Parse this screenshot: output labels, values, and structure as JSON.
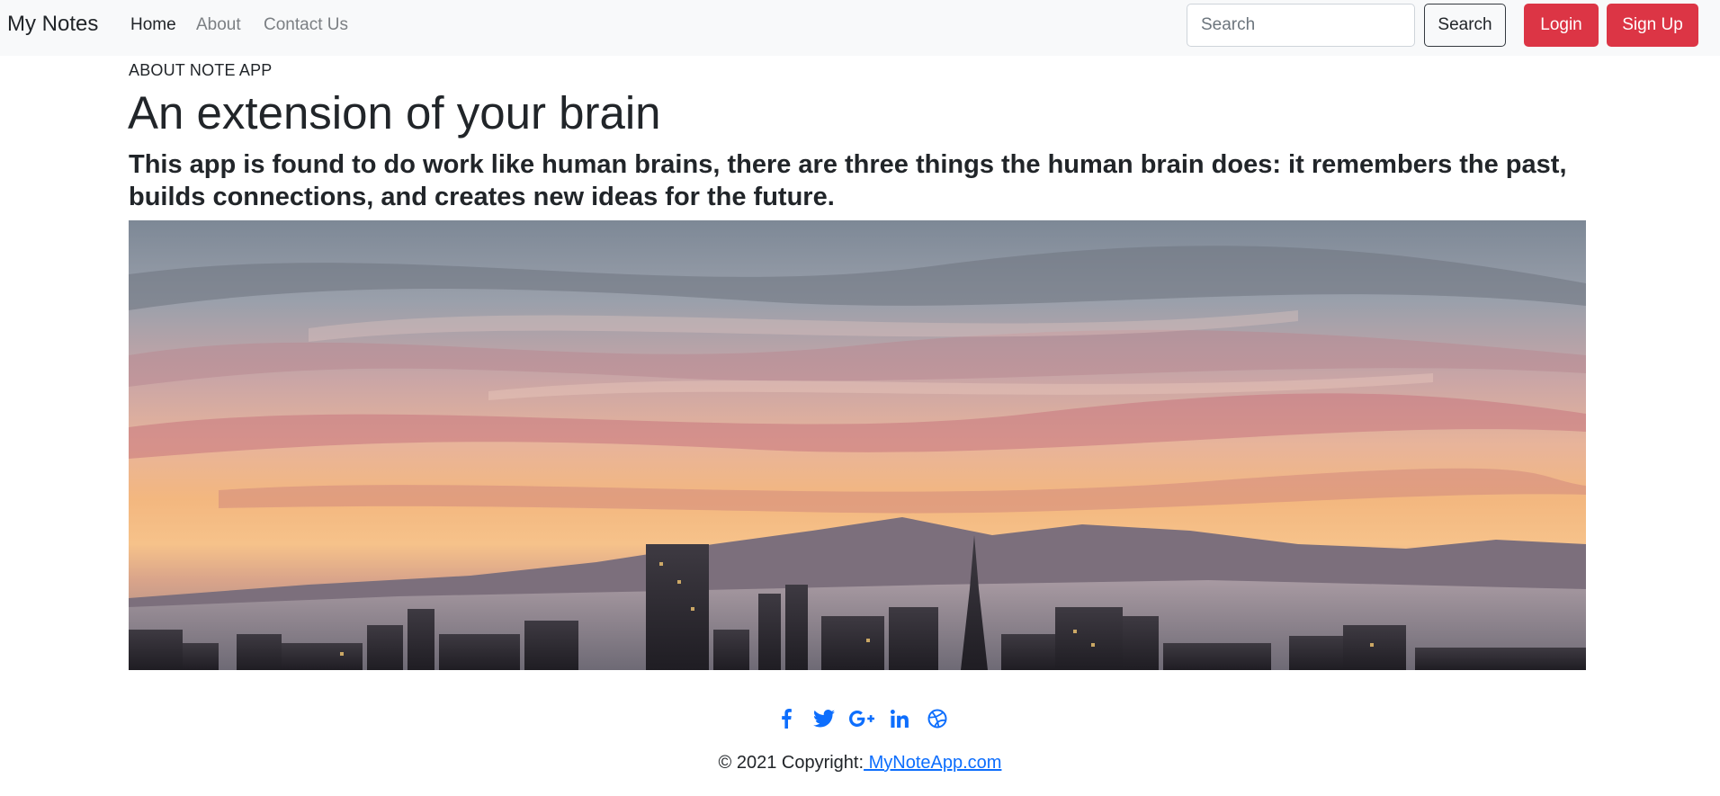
{
  "navbar": {
    "brand": "My Notes",
    "links": [
      {
        "label": "Home",
        "active": true
      },
      {
        "label": "About",
        "active": false
      },
      {
        "label": "Contact Us",
        "active": false
      }
    ],
    "search_placeholder": "Search",
    "search_button": "Search",
    "login_button": "Login",
    "signup_button": "Sign Up"
  },
  "main": {
    "eyebrow": "ABOUT NOTE APP",
    "headline": "An extension of your brain",
    "lead": "This app is found to do work like human brains, there are three things the human brain does: it remembers the past, builds connections, and creates new ideas for the future."
  },
  "hero_image": {
    "subject": "city-skyline-sunset"
  },
  "footer": {
    "social_icons": [
      "facebook-icon",
      "twitter-icon",
      "google-plus-icon",
      "linkedin-icon",
      "dribbble-icon"
    ],
    "copyright_prefix": "© 2021 Copyright:",
    "copyright_link": " MyNoteApp.com"
  },
  "colors": {
    "navbar_bg": "#f8f9fa",
    "danger": "#dc3545",
    "link": "#0d6efd",
    "text": "#212529"
  }
}
